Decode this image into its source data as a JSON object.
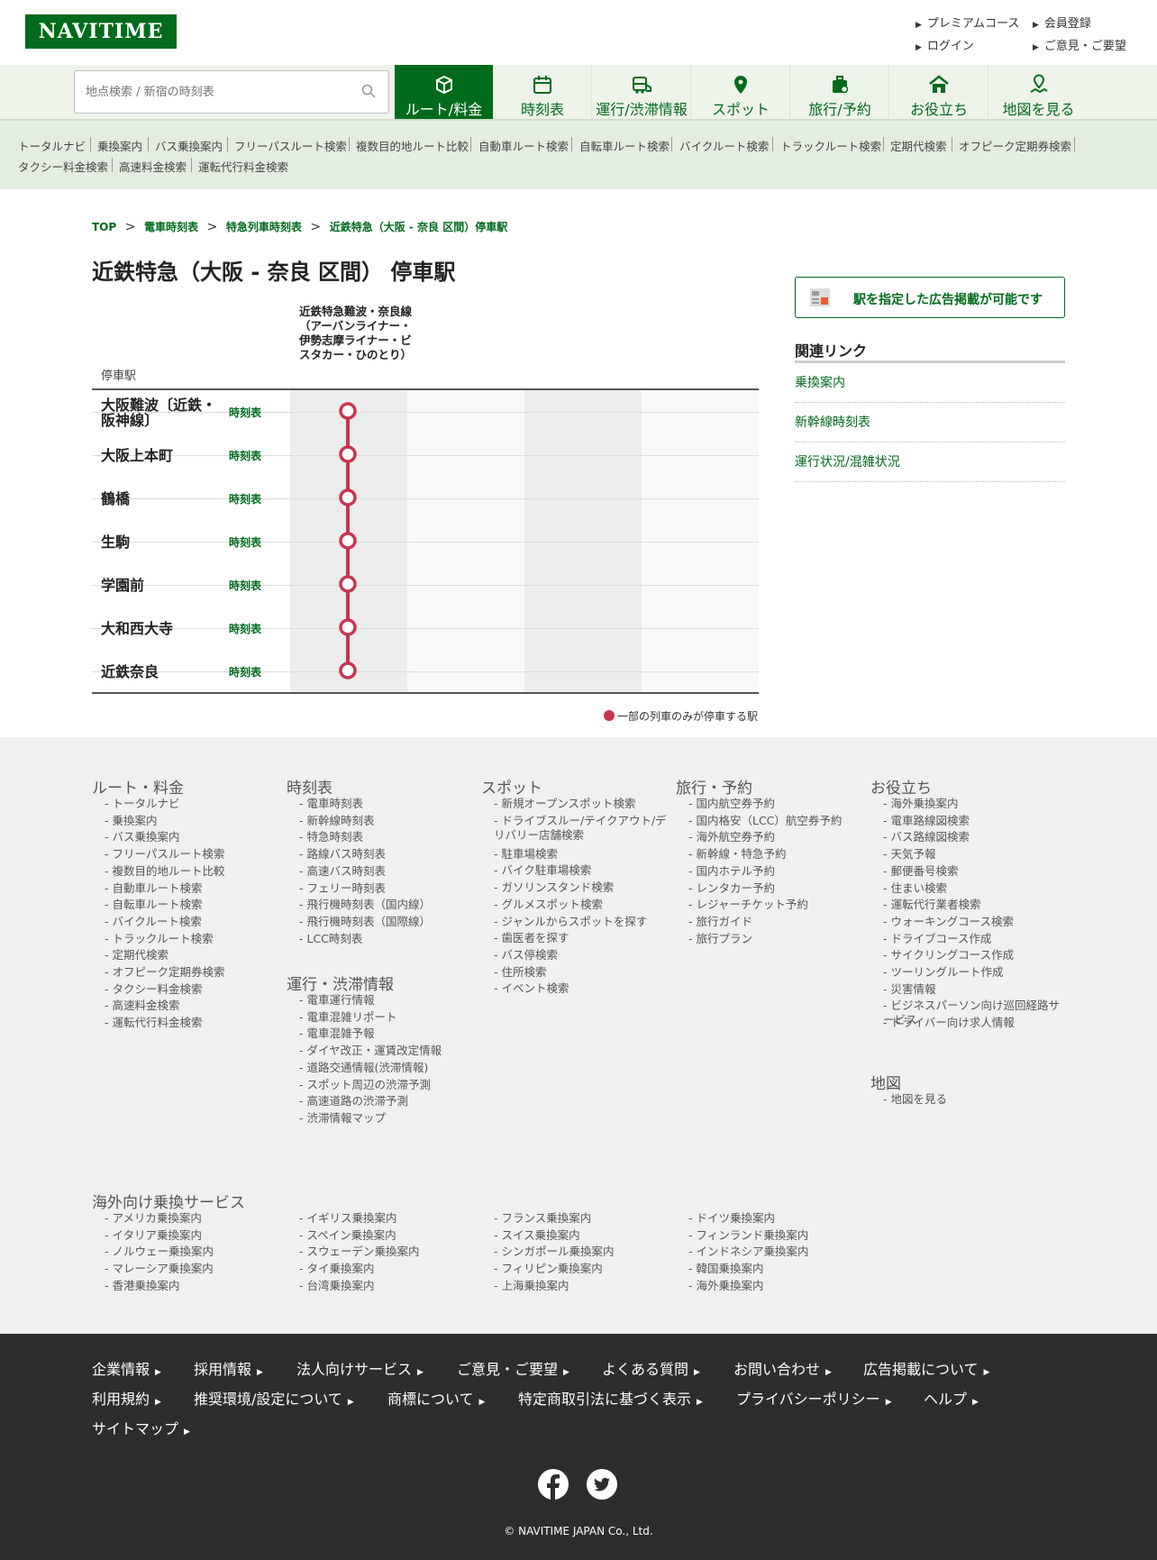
{
  "header": {
    "logo": "NAVITIME",
    "links": [
      {
        "label": "プレミアムコース"
      },
      {
        "label": "会員登録"
      },
      {
        "label": "ログイン"
      },
      {
        "label": "ご意見・ご要望"
      }
    ]
  },
  "search": {
    "placeholder": "地点検索 / 新宿の時刻表"
  },
  "nav": {
    "tabs": [
      {
        "label": "ルート/料金",
        "icon": "route-icon"
      },
      {
        "label": "時刻表",
        "icon": "timetable-icon"
      },
      {
        "label": "運行/渋滞情報",
        "icon": "traffic-info-icon"
      },
      {
        "label": "スポット",
        "icon": "pin-icon"
      },
      {
        "label": "旅行/予約",
        "icon": "luggage-icon"
      },
      {
        "label": "お役立ち",
        "icon": "home-icon"
      },
      {
        "label": "地図を見る",
        "icon": "map-icon"
      }
    ]
  },
  "subnav": [
    "トータルナビ",
    "乗換案内",
    "バス乗換案内",
    "フリーパスルート検索",
    "複数目的地ルート比較",
    "自動車ルート検索",
    "自転車ルート検索",
    "バイクルート検索",
    "トラックルート検索",
    "定期代検索",
    "オフピーク定期券検索",
    "タクシー料金検索",
    "高速料金検索",
    "運転代行料金検索"
  ],
  "breadcrumb": [
    "TOP",
    "電車時刻表",
    "特急列車時刻表",
    "近鉄特急（大阪 - 奈良 区間）停車駅"
  ],
  "page": {
    "title": "近鉄特急（大阪 - 奈良 区間） 停車駅",
    "column_label": "停車駅",
    "line_name": "近鉄特急難波・奈良線（アーバンライナー・伊勢志摩ライナー・ビスタカー・ひのとり）",
    "timetable_label": "時刻表",
    "stations": [
      "大阪難波〔近鉄・阪神線〕",
      "大阪上本町",
      "鶴橋",
      "生駒",
      "学園前",
      "大和西大寺",
      "近鉄奈良"
    ],
    "legend": "一部の列車のみが停車する駅",
    "line_color": "#c8344f"
  },
  "sidebar": {
    "ad": "駅を指定した広告掲載が可能です",
    "related_title": "関連リンク",
    "related": [
      "乗換案内",
      "新幹線時刻表",
      "運行状況/混雑状況"
    ]
  },
  "footer": {
    "cols": [
      {
        "title": "ルート・料金",
        "items": [
          "トータルナビ",
          "乗換案内",
          "バス乗換案内",
          "フリーパスルート検索",
          "複数目的地ルート比較",
          "自動車ルート検索",
          "自転車ルート検索",
          "バイクルート検索",
          "トラックルート検索",
          "定期代検索",
          "オフピーク定期券検索",
          "タクシー料金検索",
          "高速料金検索",
          "運転代行料金検索"
        ]
      },
      {
        "title": "時刻表",
        "items": [
          "電車時刻表",
          "新幹線時刻表",
          "特急時刻表",
          "路線バス時刻表",
          "高速バス時刻表",
          "フェリー時刻表",
          "飛行機時刻表（国内線）",
          "飛行機時刻表（国際線）",
          "LCC時刻表"
        ]
      },
      {
        "title": "運行・渋滞情報",
        "items": [
          "電車運行情報",
          "電車混雑リポート",
          "電車混雑予報",
          "ダイヤ改正・運賃改定情報",
          "道路交通情報(渋滞情報)",
          "スポット周辺の渋滞予測",
          "高速道路の渋滞予測",
          "渋滞情報マップ"
        ]
      },
      {
        "title": "スポット",
        "items": [
          "新規オープンスポット検索",
          "ドライブスルー/テイクアウト/デリバリー店舗検索",
          "駐車場検索",
          "バイク駐車場検索",
          "ガソリンスタンド検索",
          "グルメスポット検索",
          "ジャンルからスポットを探す",
          "歯医者を探す",
          "バス停検索",
          "住所検索",
          "イベント検索"
        ]
      },
      {
        "title": "旅行・予約",
        "items": [
          "国内航空券予約",
          "国内格安（LCC）航空券予約",
          "海外航空券予約",
          "新幹線・特急予約",
          "国内ホテル予約",
          "レンタカー予約",
          "レジャーチケット予約",
          "旅行ガイド",
          "旅行プラン"
        ]
      },
      {
        "title": "お役立ち",
        "items": [
          "海外乗換案内",
          "電車路線図検索",
          "バス路線図検索",
          "天気予報",
          "郵便番号検索",
          "住まい検索",
          "運転代行業者検索",
          "ウォーキングコース検索",
          "ドライブコース作成",
          "サイクリングコース作成",
          "ツーリングルート作成",
          "災害情報",
          "ビジネスパーソン向け巡回経路サービス",
          "ドライバー向け求人情報"
        ]
      },
      {
        "title": "地図",
        "items": [
          "地図を見る"
        ]
      }
    ],
    "overseas_title": "海外向け乗換サービス",
    "overseas": [
      "アメリカ乗換案内",
      "イギリス乗換案内",
      "フランス乗換案内",
      "ドイツ乗換案内",
      "イタリア乗換案内",
      "スペイン乗換案内",
      "スイス乗換案内",
      "フィンランド乗換案内",
      "ノルウェー乗換案内",
      "スウェーデン乗換案内",
      "シンガポール乗換案内",
      "インドネシア乗換案内",
      "マレーシア乗換案内",
      "タイ乗換案内",
      "フィリピン乗換案内",
      "韓国乗換案内",
      "香港乗換案内",
      "台湾乗換案内",
      "上海乗換案内",
      "海外乗換案内"
    ],
    "bottom_links": [
      "企業情報",
      "採用情報",
      "法人向けサービス",
      "ご意見・ご要望",
      "よくある質問",
      "お問い合わせ",
      "広告掲載について",
      "利用規約",
      "推奨環境/設定について",
      "商標について",
      "特定商取引法に基づく表示",
      "プライバシーポリシー",
      "ヘルプ",
      "サイトマップ"
    ],
    "copyright": "© NAVITIME JAPAN Co., Ltd."
  },
  "colors": {
    "brand": "#006b1c",
    "line": "#c8344f"
  }
}
